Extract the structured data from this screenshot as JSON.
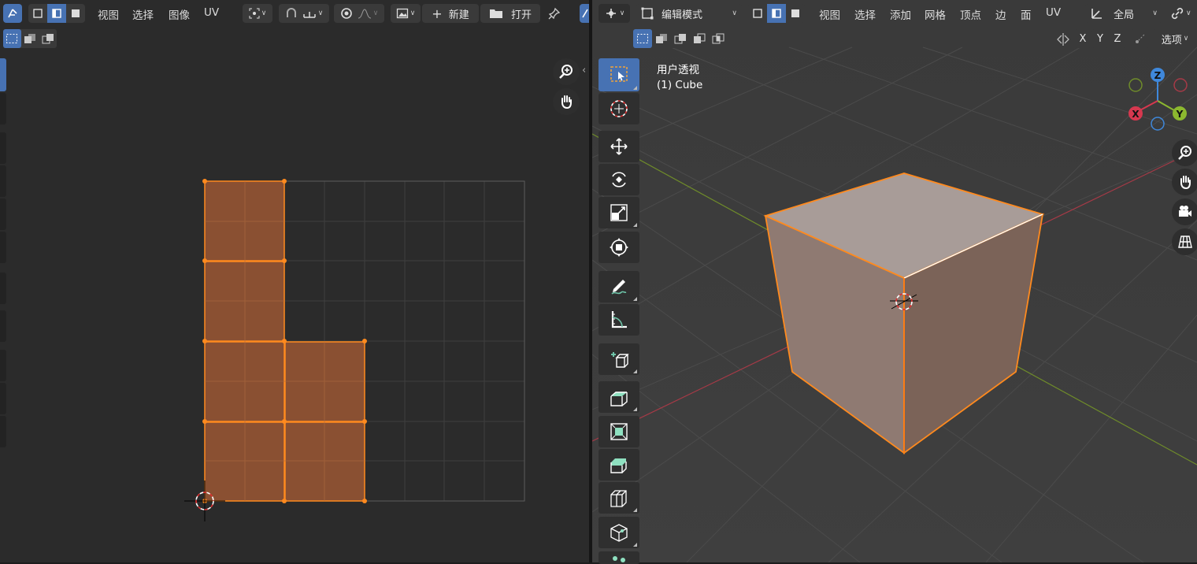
{
  "uv_editor": {
    "menus": {
      "view": "视图",
      "select": "选择",
      "image": "图像",
      "uv": "UV"
    },
    "buttons": {
      "new": "新建",
      "open": "打开"
    },
    "icons": [
      "editor-type-icon",
      "sync-selection-icon",
      "vertex-select-icon",
      "edge-select-icon",
      "face-select-icon",
      "pivot-icon",
      "snap-icon",
      "snap-increment-icon",
      "proportional-edit-icon",
      "falloff-icon",
      "image-browse-icon",
      "plus-icon",
      "folder-icon",
      "pin-icon",
      "zoom-icon",
      "hand-pan-icon"
    ]
  },
  "viewport": {
    "mode_label": "编辑模式",
    "menus": {
      "view": "视图",
      "select": "选择",
      "add": "添加",
      "mesh": "网格",
      "vertex": "顶点",
      "edge": "边",
      "face": "面",
      "uv": "UV"
    },
    "transform_orientation": "全局",
    "options_label": "选项",
    "axes": {
      "x": "X",
      "y": "Y",
      "z": "Z"
    },
    "overlay_title": "用户透视",
    "object_label": "(1) Cube",
    "gizmo": {
      "x": "X",
      "y": "Y",
      "z": "Z"
    },
    "colors": {
      "x_axis": "#d6384f",
      "y_axis": "#8cb82f",
      "z_axis": "#3f88db",
      "selection": "#ff8a1e",
      "accent": "#4772b3"
    },
    "tools": [
      "select-box",
      "cursor",
      "move",
      "rotate",
      "scale",
      "transform",
      "annotate",
      "measure",
      "add-cube",
      "extrude-region",
      "inset-faces",
      "bevel",
      "loop-cut",
      "knife",
      "poly-build"
    ]
  }
}
